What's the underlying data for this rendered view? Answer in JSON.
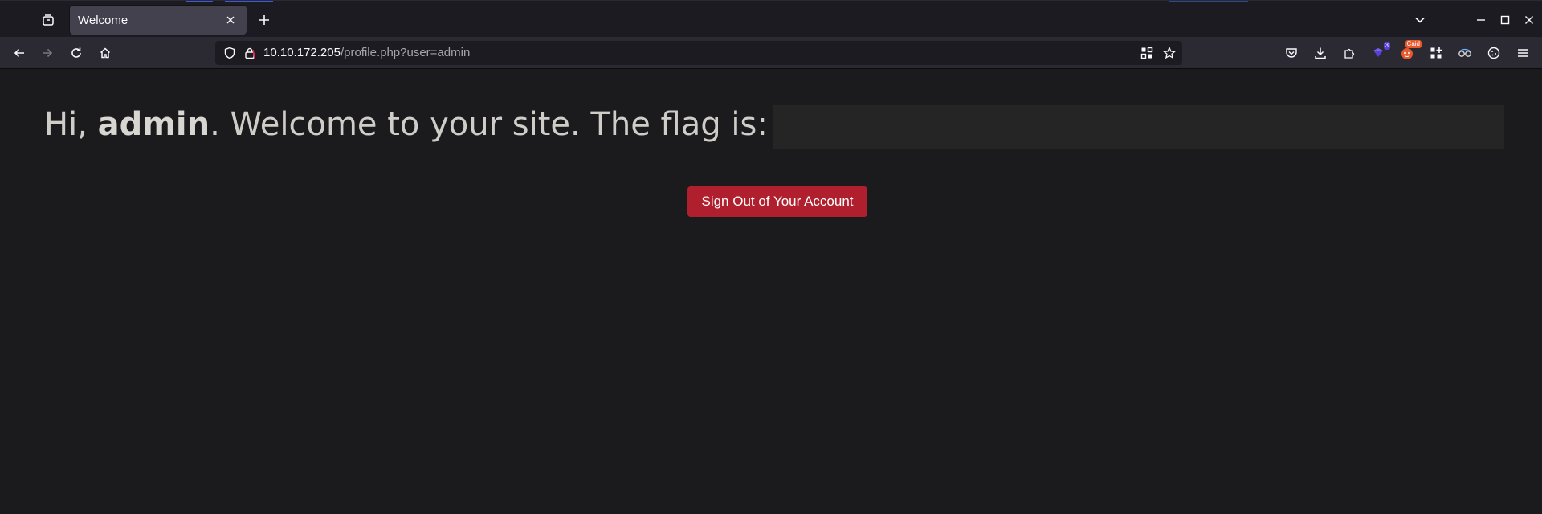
{
  "browser": {
    "tab": {
      "title": "Welcome"
    },
    "urlbar": {
      "host": "10.10.172.205",
      "path": "/profile.php?user=admin"
    },
    "extensions": {
      "badge_count": "3",
      "badge_count_color": "#5b3fd6",
      "caido_badge": "Caid",
      "caido_badge_color": "#e8582c"
    },
    "icons": {
      "tab_overview": "tab-overview-icon",
      "close": "close-icon",
      "new_tab": "plus-icon",
      "list_all_tabs": "chevron-down-icon",
      "minimize": "minimize-icon",
      "maximize": "maximize-icon",
      "close_window": "close-window-icon",
      "back": "back-arrow-icon",
      "forward": "forward-arrow-icon",
      "reload": "reload-icon",
      "home": "home-icon",
      "shield": "shield-icon",
      "lock": "lock-icon",
      "qr": "qr-code-icon",
      "bookmark": "star-icon",
      "pocket": "pocket-icon",
      "downloads": "download-icon",
      "extensions": "puzzle-icon",
      "menu": "hamburger-menu-icon"
    }
  },
  "page": {
    "greeting_prefix": "Hi, ",
    "username": "admin",
    "greeting_suffix": ". Welcome to your site. The flag is:",
    "signout_label": "Sign Out of Your Account",
    "accent_color": "#b01f2e"
  }
}
